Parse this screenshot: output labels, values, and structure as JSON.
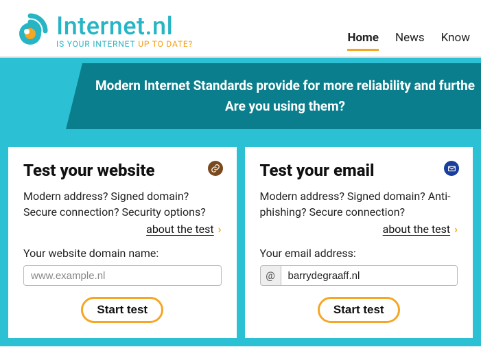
{
  "logo": {
    "title": "Internet.nl",
    "sub1": "IS YOUR INTERNET",
    "sub2": "UP TO DATE?"
  },
  "nav": {
    "home": "Home",
    "news": "News",
    "know": "Know"
  },
  "banner": {
    "line1": "Modern Internet Standards provide for more reliability and furthe",
    "line2": "Are you using them?"
  },
  "cards": {
    "website": {
      "title": "Test your website",
      "desc": "Modern address? Signed domain? Secure connection? Security options?",
      "about": "about the test",
      "label": "Your website domain name:",
      "placeholder": "www.example.nl",
      "value": "",
      "button": "Start test"
    },
    "email": {
      "title": "Test your email",
      "desc": "Modern address? Signed domain? Anti-phishing? Secure connection?",
      "about": "about the test",
      "label": "Your email address:",
      "prefix": "@",
      "value": "barrydegraaff.nl",
      "button": "Start test"
    }
  }
}
